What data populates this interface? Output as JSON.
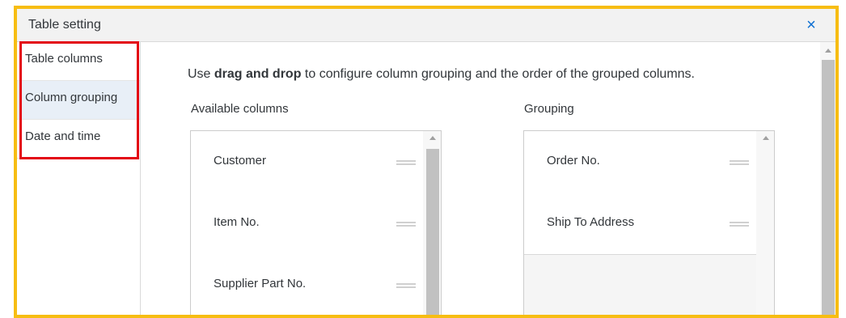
{
  "dialog": {
    "title": "Table setting",
    "close_icon": "×"
  },
  "sidebar": {
    "items": [
      {
        "label": "Table columns",
        "active": false
      },
      {
        "label": "Column grouping",
        "active": true
      },
      {
        "label": "Date and time",
        "active": false
      }
    ]
  },
  "content": {
    "instruction_prefix": "Use ",
    "instruction_bold": "drag and drop",
    "instruction_suffix": " to configure column grouping and the order of the grouped columns.",
    "available": {
      "label": "Available columns",
      "items": [
        "Customer",
        "Item No.",
        "Supplier Part No."
      ]
    },
    "grouping": {
      "label": "Grouping",
      "items": [
        "Order No.",
        "Ship To Address"
      ]
    }
  },
  "colors": {
    "highlight_outer": "#f7bd13",
    "highlight_sidebar": "#e30613",
    "accent": "#0a6ed1"
  }
}
